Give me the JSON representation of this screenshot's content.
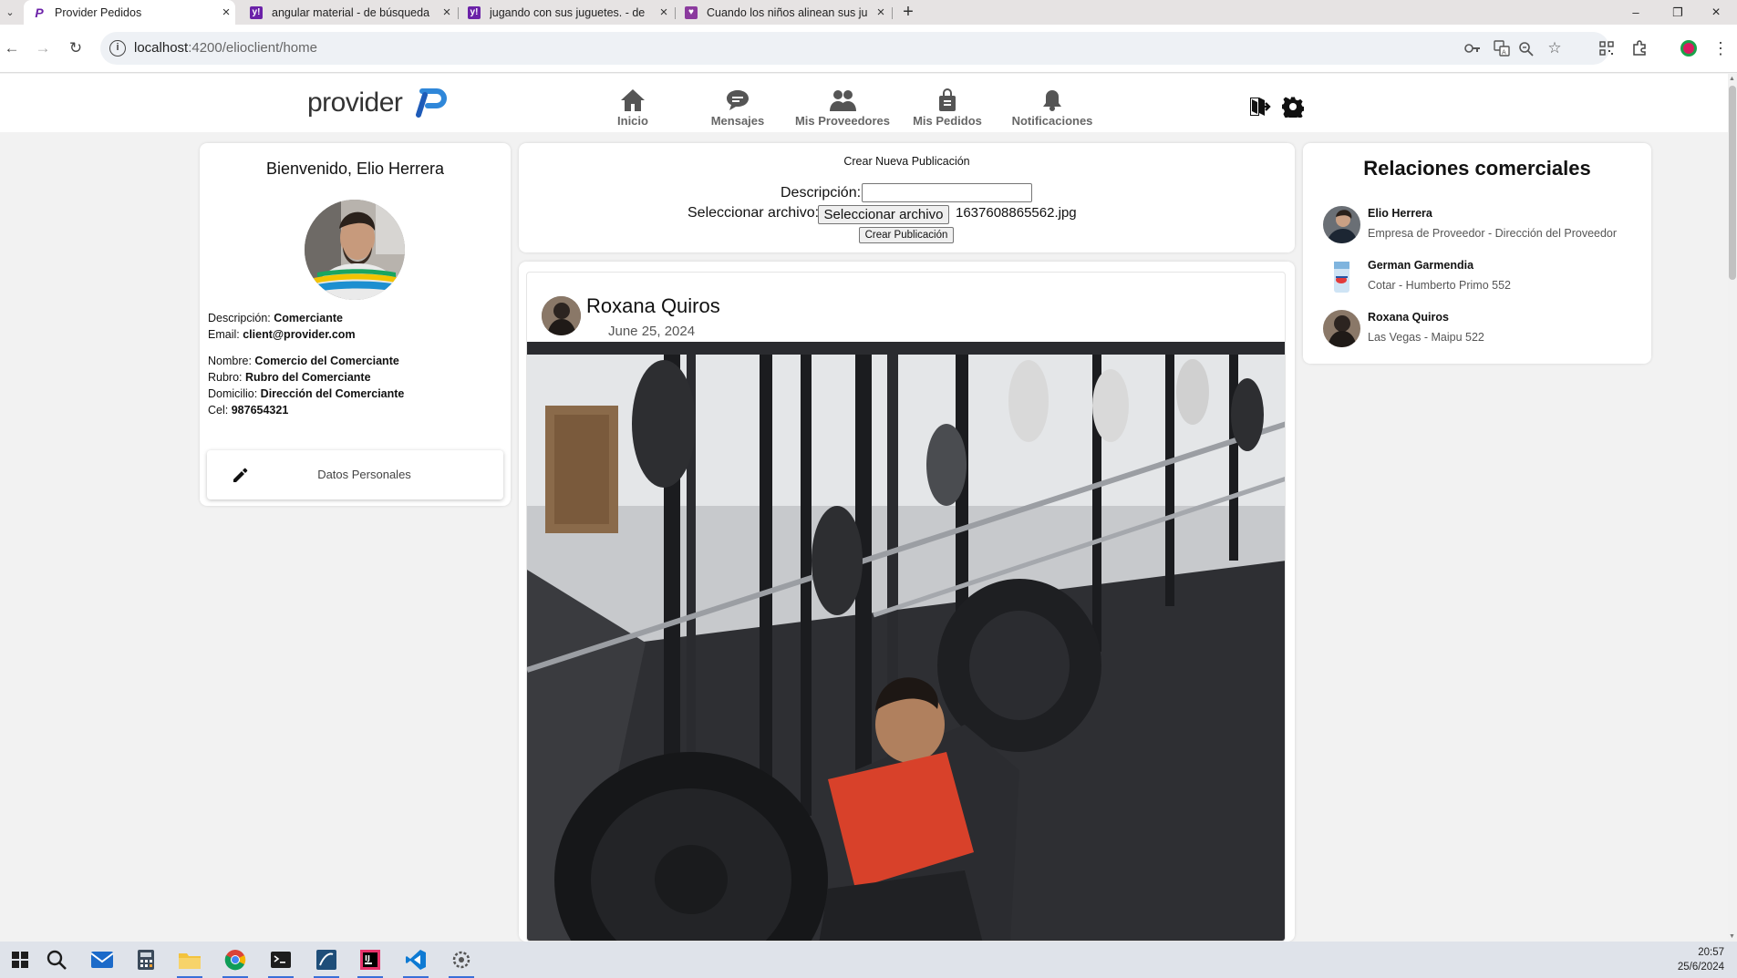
{
  "browser": {
    "tabs": [
      {
        "title": "Provider Pedidos",
        "favicon": "provider-logo-icon",
        "active": true
      },
      {
        "title": "angular material - de búsqueda",
        "favicon": "yahoo-icon",
        "active": false
      },
      {
        "title": "jugando con sus juguetes. - de",
        "favicon": "yahoo-icon",
        "active": false
      },
      {
        "title": "Cuando los niños alinean sus ju",
        "favicon": "heart-icon",
        "active": false
      }
    ],
    "new_tab": "+",
    "url_host": "localhost",
    "url_rest": ":4200/elioclient/home"
  },
  "app": {
    "logo_text": "provider",
    "nav": [
      {
        "label": "Inicio",
        "icon": "home-icon"
      },
      {
        "label": "Mensajes",
        "icon": "chat-icon"
      },
      {
        "label": "Mis Proveedores",
        "icon": "users-icon"
      },
      {
        "label": "Mis Pedidos",
        "icon": "shopping-bag-icon"
      },
      {
        "label": "Notificaciones",
        "icon": "bell-icon"
      }
    ],
    "colors": {
      "brand": "#1e5bb8",
      "brand_light": "#2f87d9"
    }
  },
  "profile": {
    "welcome": "Bienvenido, Elio Herrera",
    "descripcion_label": "Descripción:",
    "descripcion": "Comerciante",
    "email_label": "Email:",
    "email": "client@provider.com",
    "nombre_label": "Nombre:",
    "nombre": "Comercio del Comerciante",
    "rubro_label": "Rubro:",
    "rubro": "Rubro del Comerciante",
    "domicilio_label": "Domicilio:",
    "domicilio": "Dirección del Comerciante",
    "cel_label": "Cel:",
    "cel": "987654321",
    "edit_label": "Datos Personales"
  },
  "new_post": {
    "title": "Crear Nueva Publicación",
    "descripcion_label": "Descripción:",
    "descripcion_value": "",
    "file_label": "Seleccionar archivo:",
    "file_button": "Seleccionar archivo",
    "file_name": "1637608865562.jpg",
    "submit": "Crear Publicación"
  },
  "feed": {
    "author": "Roxana Quiros",
    "date": "June 25, 2024"
  },
  "relations": {
    "title": "Relaciones comerciales",
    "items": [
      {
        "name": "Elio Herrera",
        "detail": "Empresa de Proveedor - Dirección del Proveedor"
      },
      {
        "name": "German Garmendia",
        "detail": "Cotar - Humberto Primo 552"
      },
      {
        "name": "Roxana Quiros",
        "detail": "Las Vegas - Maipu 522"
      }
    ]
  },
  "taskbar": {
    "time": "20:57",
    "date": "25/6/2024"
  }
}
